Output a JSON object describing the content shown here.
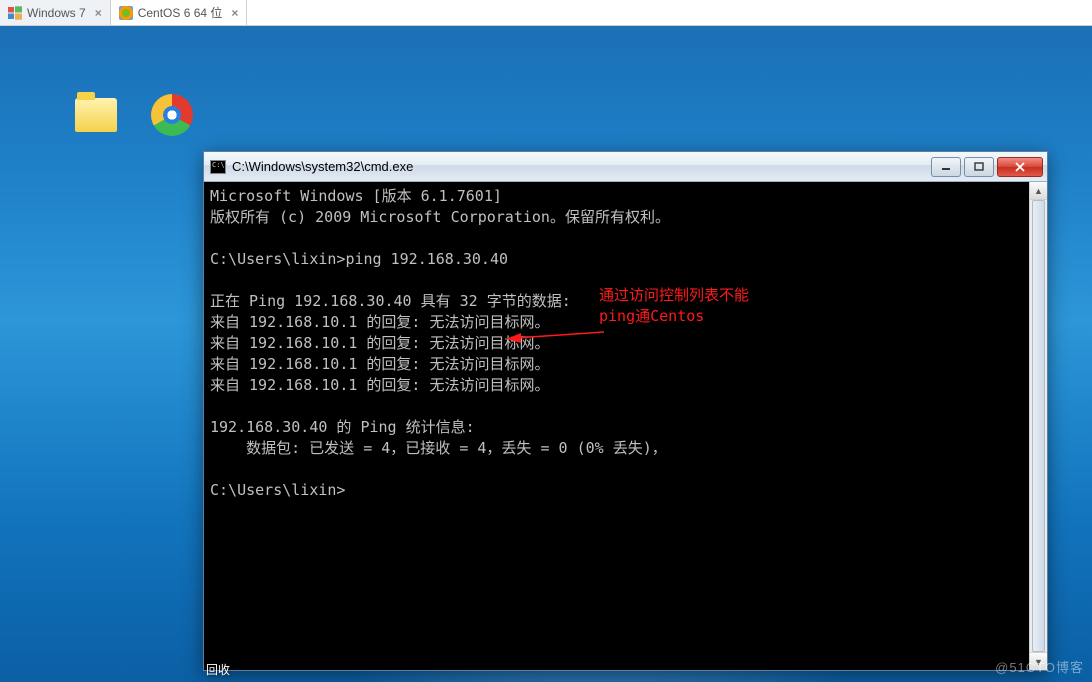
{
  "tabs": [
    {
      "label": "Windows 7",
      "active": true
    },
    {
      "label": "CentOS 6 64 位",
      "active": false
    }
  ],
  "desktop": {
    "icon_trunc_label": "回收"
  },
  "cmd": {
    "title": "C:\\Windows\\system32\\cmd.exe",
    "lines": {
      "l0": "Microsoft Windows [版本 6.1.7601]",
      "l1": "版权所有 (c) 2009 Microsoft Corporation。保留所有权利。",
      "l2": "",
      "l3": "C:\\Users\\lixin>ping 192.168.30.40",
      "l4": "",
      "l5": "正在 Ping 192.168.30.40 具有 32 字节的数据:",
      "l6": "来自 192.168.10.1 的回复: 无法访问目标网。",
      "l7": "来自 192.168.10.1 的回复: 无法访问目标网。",
      "l8": "来自 192.168.10.1 的回复: 无法访问目标网。",
      "l9": "来自 192.168.10.1 的回复: 无法访问目标网。",
      "l10": "",
      "l11": "192.168.30.40 的 Ping 统计信息:",
      "l12": "    数据包: 已发送 = 4，已接收 = 4，丢失 = 0 (0% 丢失)，",
      "l13": "",
      "l14": "C:\\Users\\lixin>"
    },
    "annotation_line1": "通过访问控制列表不能",
    "annotation_line2": "ping通Centos"
  },
  "watermark": "@51CTO博客"
}
